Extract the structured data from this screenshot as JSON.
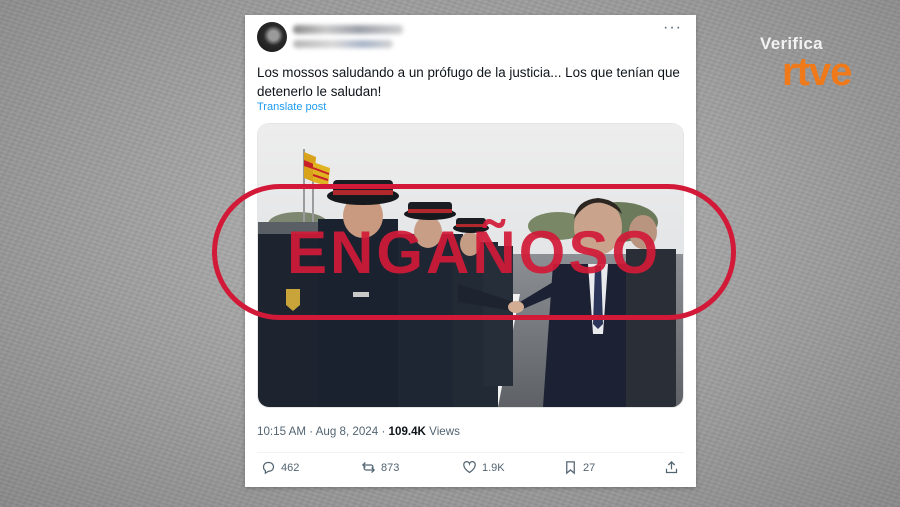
{
  "overlay": {
    "brand_top": "Verifica",
    "brand_bottom": "rtve",
    "stamp": "ENGAÑOSO",
    "stamp_color": "#d21a38"
  },
  "tweet": {
    "text": "Los mossos saludando a un prófugo de la justicia... Los que tenían que detenerlo le saludan!",
    "translate_label": "Translate post",
    "time": "10:15 AM",
    "date": "Aug 8, 2024",
    "views_count": "109.4K",
    "views_label": "Views",
    "more_icon": "ellipsis-icon"
  },
  "actions": {
    "replies": "462",
    "reposts": "873",
    "likes": "1.9K",
    "bookmarks": "27"
  },
  "colors": {
    "brand_orange": "#f07a1a",
    "link_blue": "#1d9bf0",
    "muted": "#536471"
  }
}
